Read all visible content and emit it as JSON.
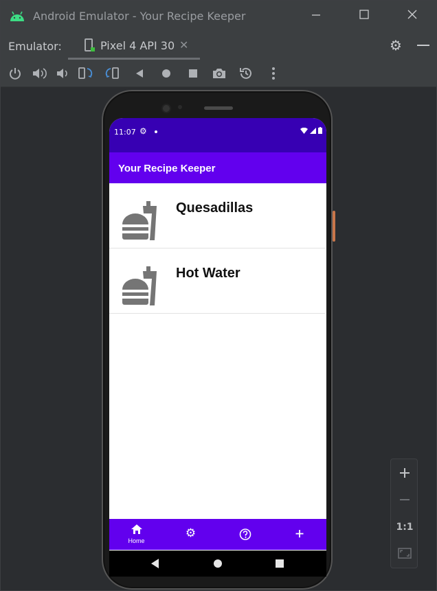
{
  "window": {
    "title": "Android Emulator - Your Recipe Keeper",
    "controls": [
      "minimize",
      "maximize",
      "close"
    ]
  },
  "tabbar": {
    "label": "Emulator:",
    "tab_label": "Pixel 4 API 30"
  },
  "toolbar": {
    "tools": [
      "power-icon",
      "volume-up-icon",
      "volume-down-icon",
      "rotate-left-icon",
      "rotate-right-icon",
      "back-icon",
      "home-icon",
      "overview-icon",
      "screenshot-icon",
      "snapshot-icon",
      "more-icon"
    ]
  },
  "phone": {
    "status": {
      "time": "11:07"
    },
    "appbar": {
      "title": "Your Recipe Keeper"
    },
    "recipes": [
      {
        "title": "Quesadillas"
      },
      {
        "title": "Hot Water"
      }
    ],
    "bottom_nav": {
      "home_label": "Home"
    }
  },
  "zoom": {
    "one_to_one": "1:1"
  },
  "colors": {
    "status_bar": "#3700b3",
    "app_bar": "#6200ee",
    "ide_background": "#2b2d30",
    "icon_gray": "#757575"
  }
}
